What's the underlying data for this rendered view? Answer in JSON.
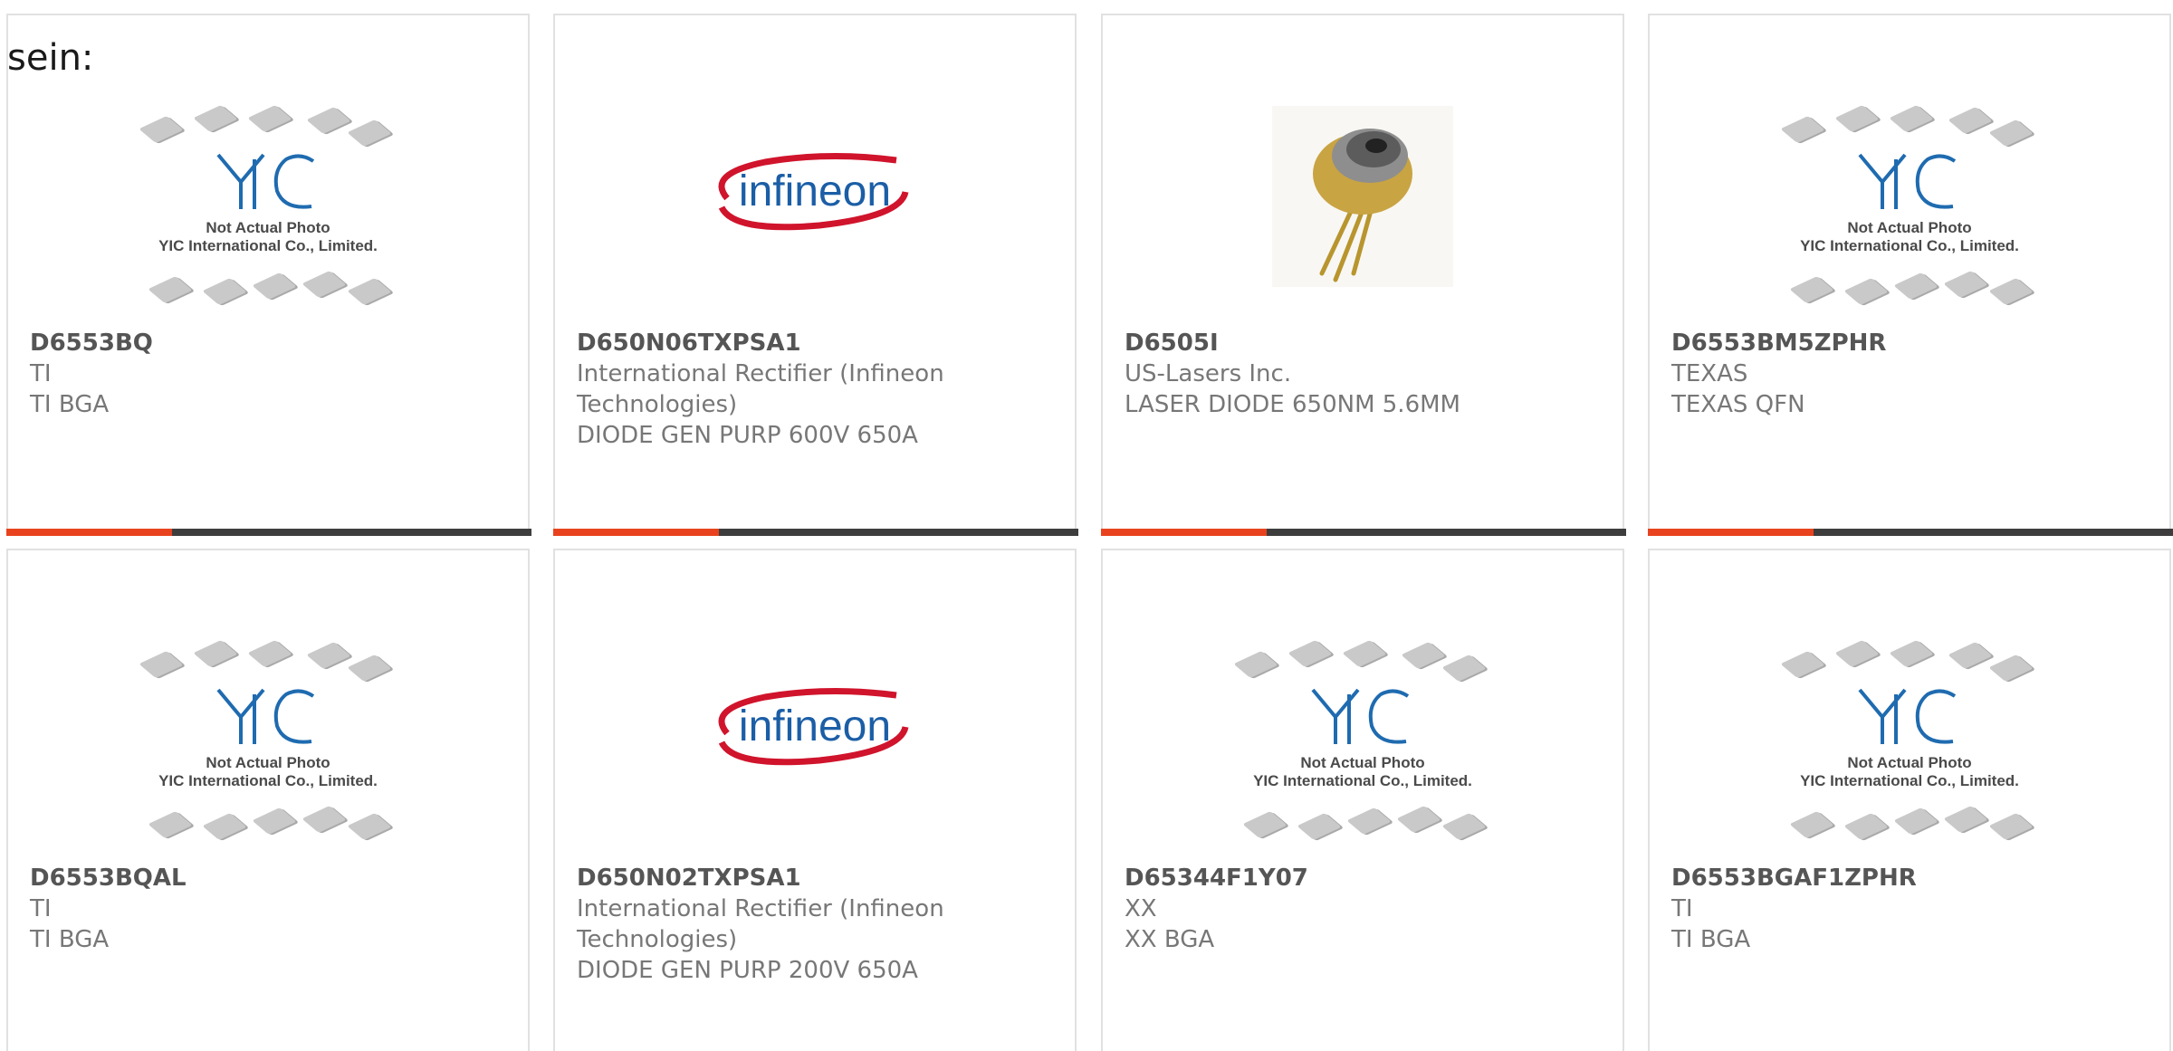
{
  "intro_text": "sein:",
  "colors": {
    "accent": "#e8431e",
    "bar": "#3d3d3d",
    "border": "#e1e1e1",
    "infineon_blue": "#1b5ea6",
    "infineon_red": "#d0142c"
  },
  "placeholder": {
    "line1": "Not Actual Photo",
    "line2": "YIC International Co., Limited.",
    "icon": "yic-logo-icon"
  },
  "brand_logo": {
    "text": "infineon",
    "icon": "infineon-logo-icon"
  },
  "products": [
    {
      "part": "D6553BQ",
      "maker": "TI",
      "desc": "TI BGA",
      "image": "yic"
    },
    {
      "part": "D650N06TXPSA1",
      "maker": "International Rectifier (Infineon Technologies)",
      "desc": "DIODE GEN PURP 600V 650A",
      "image": "infineon"
    },
    {
      "part": "D6505I",
      "maker": "US-Lasers Inc.",
      "desc": "LASER DIODE 650NM 5.6MM",
      "image": "laser"
    },
    {
      "part": "D6553BM5ZPHR",
      "maker": "TEXAS",
      "desc": "TEXAS QFN",
      "image": "yic"
    },
    {
      "part": "D6553BQAL",
      "maker": "TI",
      "desc": "TI BGA",
      "image": "yic"
    },
    {
      "part": "D650N02TXPSA1",
      "maker": "International Rectifier (Infineon Technologies)",
      "desc": "DIODE GEN PURP 200V 650A",
      "image": "infineon"
    },
    {
      "part": "D65344F1Y07",
      "maker": "XX",
      "desc": "XX BGA",
      "image": "yic"
    },
    {
      "part": "D6553BGAF1ZPHR",
      "maker": "TI",
      "desc": "TI BGA",
      "image": "yic"
    }
  ]
}
